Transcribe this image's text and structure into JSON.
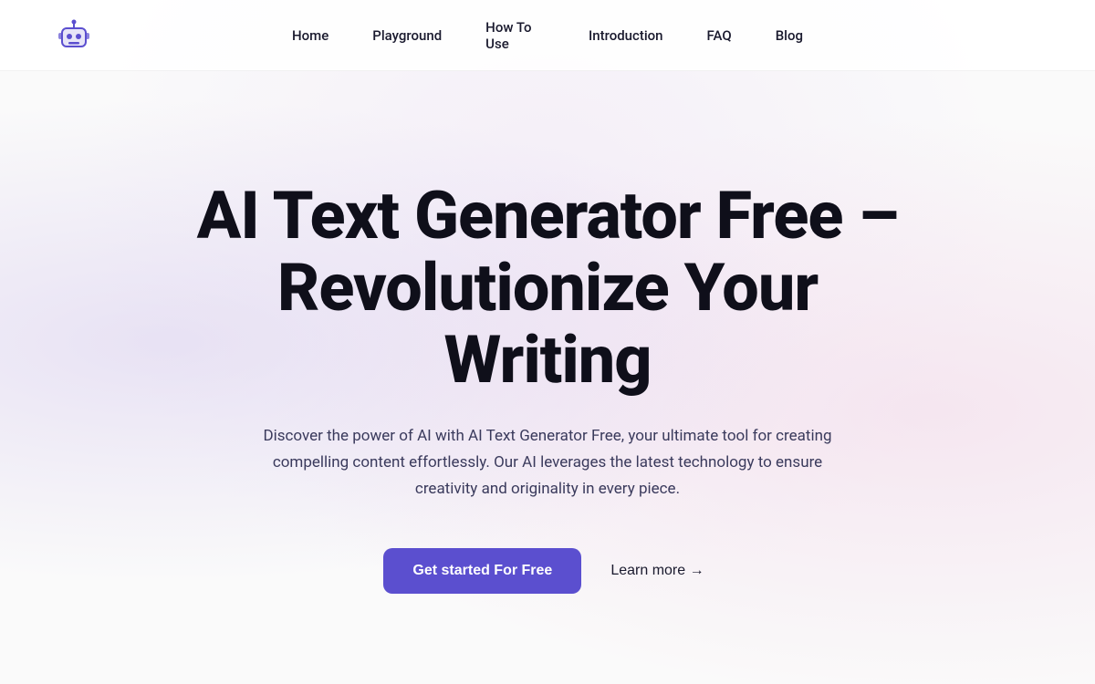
{
  "navbar": {
    "logo_alt": "AI Text Generator Logo",
    "nav_items": [
      {
        "id": "home",
        "label": "Home"
      },
      {
        "id": "playground",
        "label": "Playground"
      },
      {
        "id": "how-to-use",
        "label": "How To Use"
      },
      {
        "id": "introduction",
        "label": "Introduction"
      },
      {
        "id": "faq",
        "label": "FAQ"
      },
      {
        "id": "blog",
        "label": "Blog"
      }
    ]
  },
  "hero": {
    "title": "AI Text Generator Free – Revolutionize Your Writing",
    "subtitle": "Discover the power of AI with AI Text Generator Free, your ultimate tool for creating compelling content effortlessly. Our AI leverages the latest technology to ensure creativity and originality in every piece.",
    "cta_primary": "Get started For Free",
    "cta_secondary": "Learn more →"
  },
  "colors": {
    "accent": "#5b4fcf",
    "text_dark": "#0f0f1a",
    "text_mid": "#3a3a5c"
  }
}
